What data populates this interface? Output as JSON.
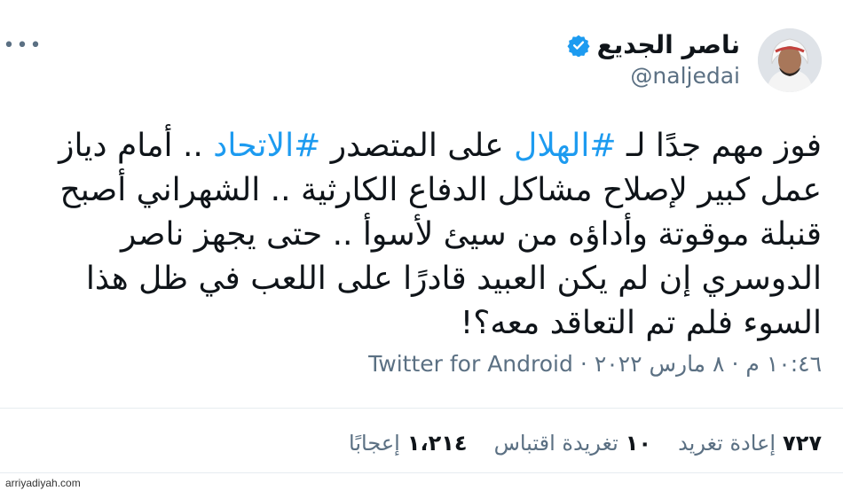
{
  "author": {
    "display_name": "ناصر الجديع",
    "handle": "@naljedai"
  },
  "tweet": {
    "line1_a": "فوز مهم جدًا لـ ",
    "hashtag1": "#الهلال",
    "line1_b": " على المتصدر ",
    "hashtag2": "#الاتحاد",
    "line1_c": " .. أمام دياز عمل كبير لإصلاح مشاكل الدفاع الكارثية .. الشهراني أصبح قنبلة موقوتة وأداؤه من سيئ لأسوأ .. حتى يجهز ناصر الدوسري إن لم يكن العبيد قادرًا على اللعب في ظل هذا السوء فلم تم التعاقد معه؟!"
  },
  "meta": {
    "time": "١٠:٤٦ م",
    "separator": "·",
    "date": "٨ مارس ٢٠٢٢",
    "source": "Twitter for Android"
  },
  "stats": {
    "retweets_num": "٧٢٧",
    "retweets_label": "إعادة تغريد",
    "quotes_num": "١٠",
    "quotes_label": "تغريدة اقتباس",
    "likes_num": "١،٢١٤",
    "likes_label": "إعجابًا"
  },
  "watermark": "arriyadiyah.com",
  "colors": {
    "link": "#1d9bf0",
    "muted": "#5b7083",
    "text": "#0f1419"
  },
  "icons": {
    "more": "more-icon",
    "verified": "verified-badge-icon"
  }
}
